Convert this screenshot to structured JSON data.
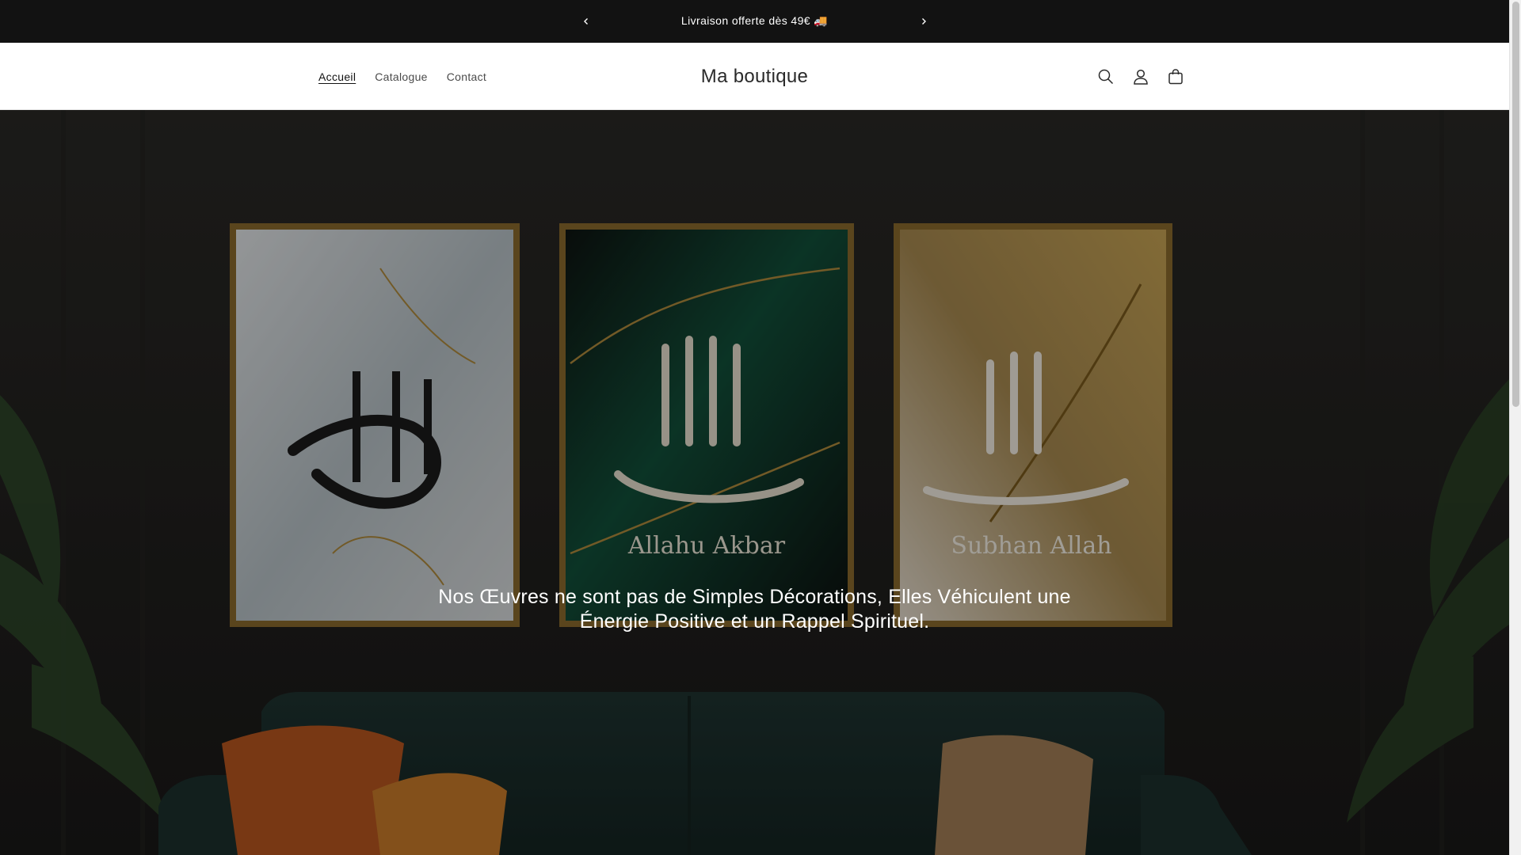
{
  "announcement": {
    "text": "Livraison offerte dès 49€ 🚚",
    "prev_icon": "chevron-left-icon",
    "next_icon": "chevron-right-icon"
  },
  "header": {
    "nav": [
      {
        "label": "Accueil",
        "active": true
      },
      {
        "label": "Catalogue",
        "active": false
      },
      {
        "label": "Contact",
        "active": false
      }
    ],
    "brand": "Ma boutique",
    "icons": [
      "search-icon",
      "account-icon",
      "cart-icon"
    ]
  },
  "hero": {
    "headline": "Nos Œuvres ne sont pas de Simples Décorations, Elles Véhiculent une Énergie Positive et un Rappel Spirituel.",
    "frames": [
      {
        "caption": ""
      },
      {
        "caption": "Allahu Akbar"
      },
      {
        "caption": "Subhan Allah"
      }
    ]
  },
  "colors": {
    "announcement_bg": "#121212",
    "header_bg": "#ffffff",
    "text_dark": "#121212",
    "hero_bg": "#1e1d1b",
    "frame_gold": "#b08a3c"
  }
}
